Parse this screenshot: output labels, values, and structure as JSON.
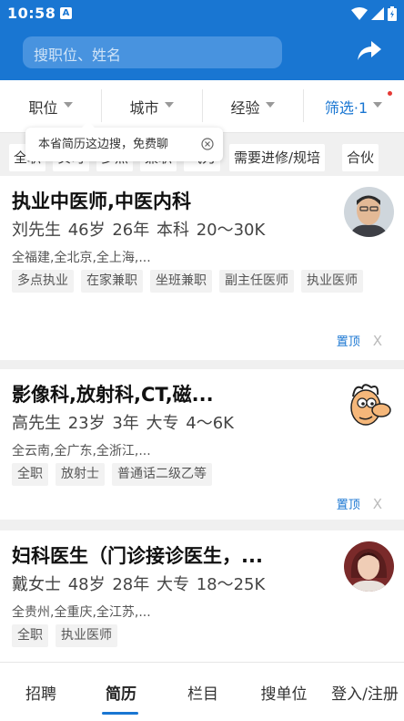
{
  "status_bar": {
    "time": "10:58",
    "notif_icon": "A"
  },
  "search": {
    "placeholder": "搜职位、姓名"
  },
  "filters": [
    {
      "label": "职位",
      "active": false
    },
    {
      "label": "城市",
      "active": false
    },
    {
      "label": "经验",
      "active": false
    },
    {
      "label": "筛选·1",
      "active": true
    }
  ],
  "tag_strip": [
    "全职",
    "实习",
    "多点",
    "兼职",
    "气力",
    "需要进修/规培",
    "合伙"
  ],
  "tooltip": {
    "text": "本省简历这边搜，免费聊"
  },
  "resumes": [
    {
      "title": "执业中医师,中医内科",
      "meta": "刘先生 46岁 26年 本科 20～30K",
      "locations": "全福建,全北京,全上海,...",
      "tags": [
        "多点执业",
        "在家兼职",
        "坐班兼职",
        "副主任医师",
        "执业医师"
      ],
      "pin_label": "置顶",
      "close_label": "X",
      "avatar_icon": "man-photo-icon"
    },
    {
      "title": "影像科,放射科,CT,磁...",
      "meta": "高先生 23岁 3年 大专 4～6K",
      "locations": "全云南,全广东,全浙江,...",
      "tags": [
        "全职",
        "放射士",
        "普通话二级乙等"
      ],
      "pin_label": "置顶",
      "close_label": "X",
      "avatar_icon": "cartoon-face-icon"
    },
    {
      "title": "妇科医生（门诊接诊医生，...",
      "meta": "戴女士 48岁 28年 大专 18～25K",
      "locations": "全贵州,全重庆,全江苏,...",
      "tags": [
        "全职",
        "执业医师"
      ],
      "pin_label": "",
      "close_label": "",
      "avatar_icon": "woman-photo-icon"
    }
  ],
  "bottom_nav": [
    {
      "label": "招聘",
      "active": false
    },
    {
      "label": "简历",
      "active": true
    },
    {
      "label": "栏目",
      "active": false
    },
    {
      "label": "搜单位",
      "active": false
    },
    {
      "label": "登入/注册",
      "active": false
    }
  ],
  "colors": {
    "brand_blue": "#1976d2",
    "red_dot": "#e53935"
  }
}
